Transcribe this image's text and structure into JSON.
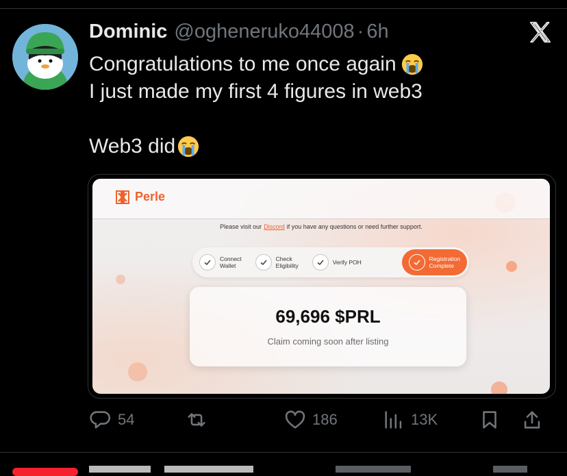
{
  "tweet": {
    "author_name": "Dominic",
    "handle": "@ogheneruko44008",
    "separator": "·",
    "time": "6h",
    "text_lines": [
      "Congratulations to me once again",
      "I just made my first 4 figures in web3",
      "Web3 did"
    ]
  },
  "media": {
    "brand": "Perle",
    "notice_before": "Please visit our",
    "notice_link": "Discord",
    "notice_after": "if you have any questions or need further support.",
    "steps": [
      {
        "label_1": "Connect",
        "label_2": "Wallet"
      },
      {
        "label_1": "Check",
        "label_2": "Eligibility"
      },
      {
        "label_1": "Verify POH",
        "label_2": ""
      },
      {
        "label_1": "Registration",
        "label_2": "Complete"
      }
    ],
    "amount": "69,696 $PRL",
    "claim_text": "Claim coming soon after listing"
  },
  "actions": {
    "replies": "54",
    "likes": "186",
    "views": "13K"
  },
  "colors": {
    "background": "#000000",
    "text": "#e7e9ea",
    "muted": "#71767b",
    "perle_orange": "#f0612c"
  }
}
